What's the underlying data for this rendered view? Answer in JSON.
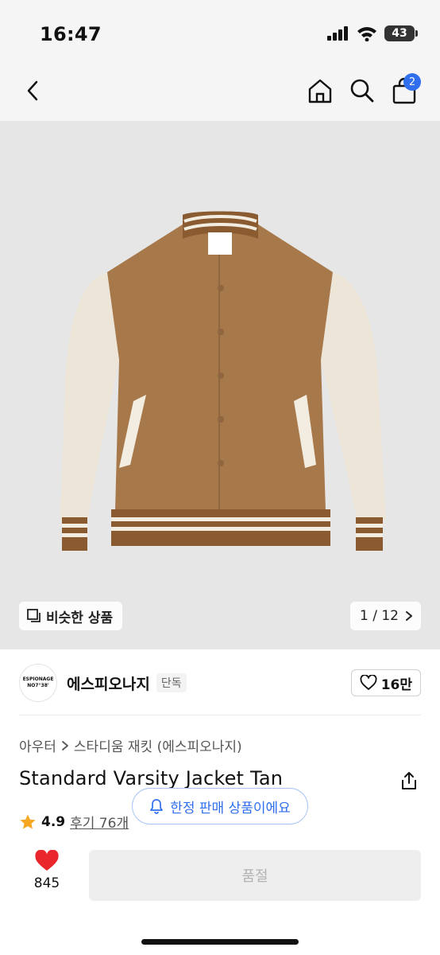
{
  "status_bar": {
    "time": "16:47",
    "battery": "43",
    "icons": [
      "signal-icon",
      "wifi-icon",
      "battery-icon"
    ]
  },
  "nav": {
    "icons": [
      "back-icon",
      "home-icon",
      "search-icon",
      "cart-icon"
    ],
    "cart_count": "2"
  },
  "gallery": {
    "similar_label": "비슷한 상품",
    "page_indicator": "1 / 12"
  },
  "brand": {
    "logo_line1": "ESPIONAGE",
    "logo_line2": "NO7°38'",
    "name": "에스피오나지",
    "tag": "단독",
    "likes": "16만"
  },
  "product": {
    "breadcrumb": [
      "아우터",
      "스타디움 재킷 (에스피오나지)"
    ],
    "title": "Standard Varsity Jacket Tan",
    "rating": "4.9",
    "reviews": "후기 76개",
    "limited_notice": "한정 판매 상품이에요"
  },
  "bottom_bar": {
    "heart_count": "845",
    "sold_out_label": "품절"
  },
  "colors": {
    "accent": "#2f6fed",
    "heart": "#e8262b",
    "star": "#f5a623",
    "jacket_body": "#a6784a",
    "jacket_sleeve": "#ece5d8"
  }
}
